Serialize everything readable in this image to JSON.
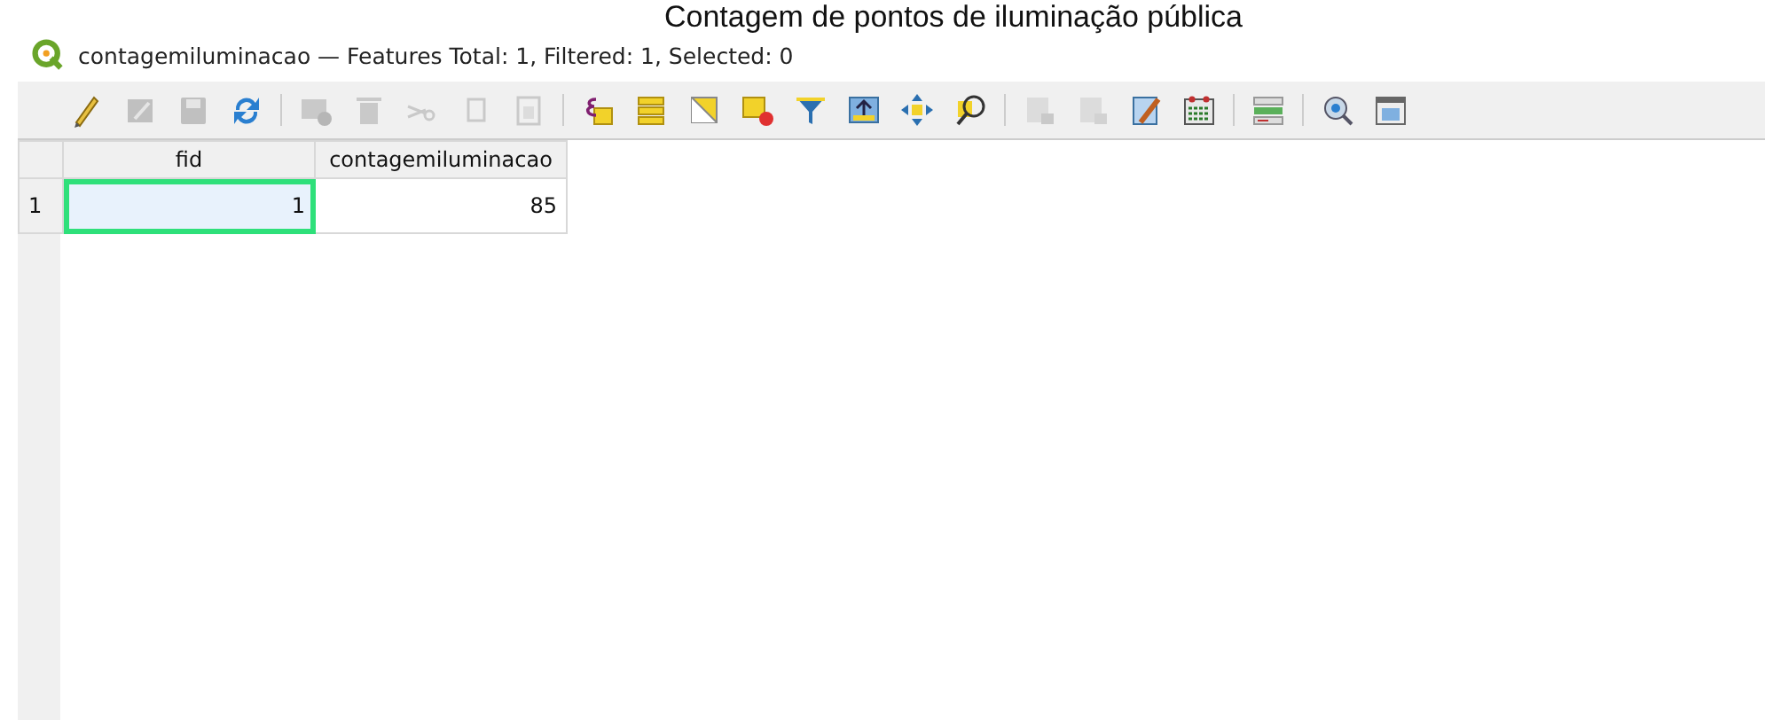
{
  "caption": "Contagem de pontos de iluminação pública",
  "window": {
    "title": "contagemiluminacao — Features Total: 1, Filtered: 1, Selected: 0"
  },
  "toolbar": [
    [
      {
        "kind": "pencil",
        "disabled": false
      },
      {
        "kind": "multiedit",
        "disabled": true
      },
      {
        "kind": "save",
        "disabled": true
      },
      {
        "kind": "reload",
        "disabled": false
      }
    ],
    [
      {
        "kind": "addrow",
        "disabled": true
      },
      {
        "kind": "trash",
        "disabled": true
      },
      {
        "kind": "cut",
        "disabled": true
      },
      {
        "kind": "copy",
        "disabled": true
      },
      {
        "kind": "paste",
        "disabled": true
      }
    ],
    [
      {
        "kind": "expression",
        "disabled": false
      },
      {
        "kind": "selectall",
        "disabled": false
      },
      {
        "kind": "invert",
        "disabled": false
      },
      {
        "kind": "deselect",
        "disabled": false
      },
      {
        "kind": "filter",
        "disabled": false
      },
      {
        "kind": "totop",
        "disabled": false
      },
      {
        "kind": "pan",
        "disabled": false
      },
      {
        "kind": "zoom",
        "disabled": false
      }
    ],
    [
      {
        "kind": "newfield",
        "disabled": true
      },
      {
        "kind": "delfield",
        "disabled": true
      },
      {
        "kind": "calculator",
        "disabled": false
      },
      {
        "kind": "formatting",
        "disabled": false
      }
    ],
    [
      {
        "kind": "actions",
        "disabled": false
      }
    ],
    [
      {
        "kind": "magnify",
        "disabled": false
      },
      {
        "kind": "dock",
        "disabled": false
      }
    ]
  ],
  "table": {
    "columns": [
      "fid",
      "contagemiluminacao"
    ],
    "rows": [
      {
        "header": "1",
        "cells": [
          {
            "value": "1",
            "selected": true
          },
          {
            "value": "85",
            "selected": false
          }
        ]
      }
    ]
  }
}
